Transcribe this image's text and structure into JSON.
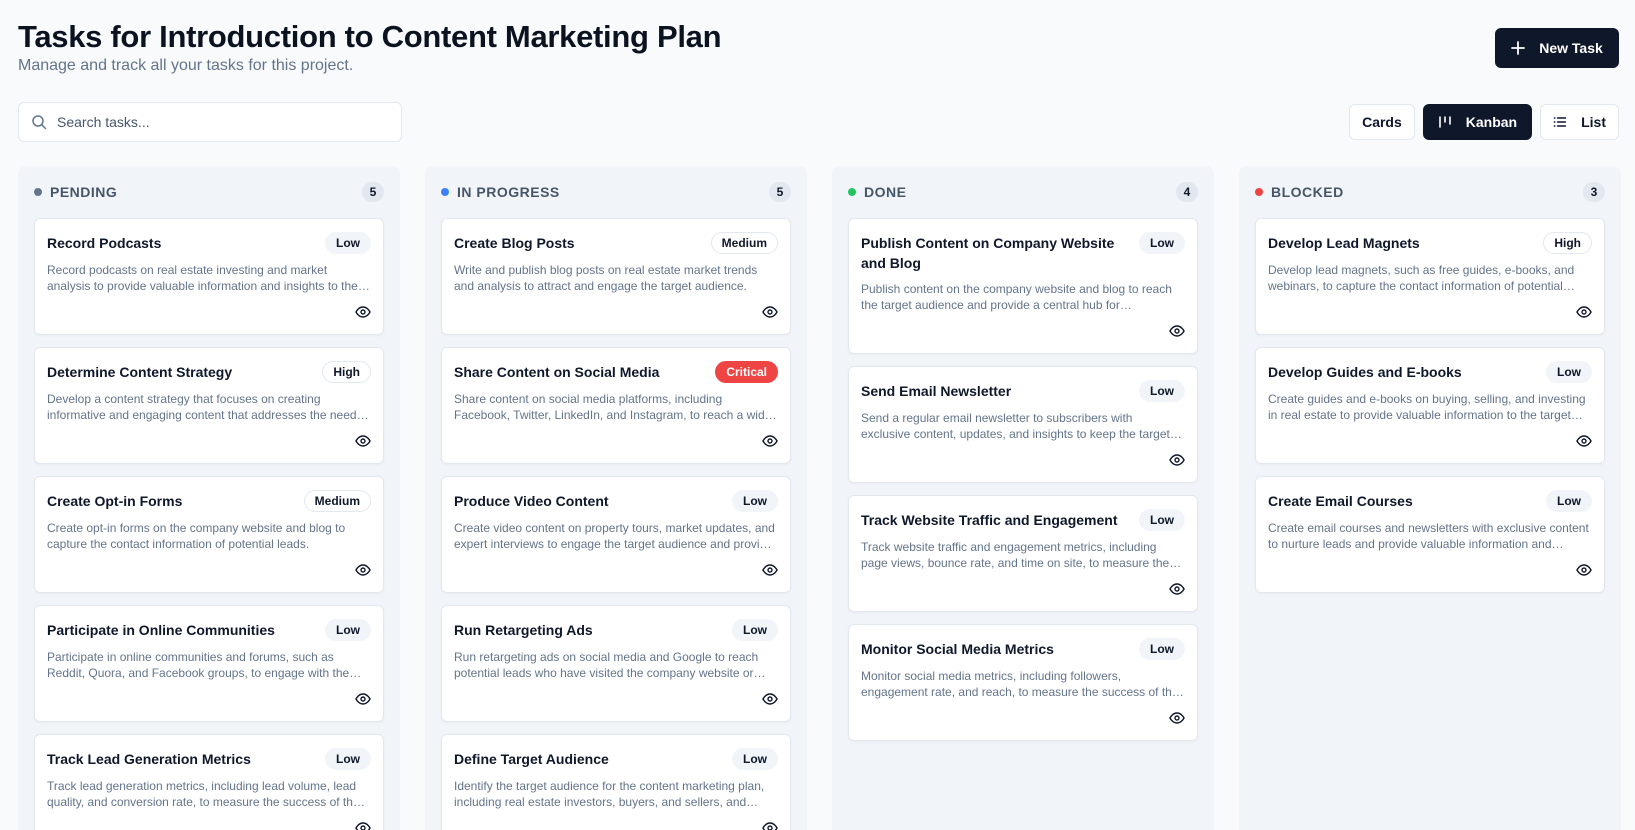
{
  "header": {
    "title": "Tasks for Introduction to Content Marketing Plan",
    "subtitle": "Manage and track all your tasks for this project.",
    "new_task_label": "New Task"
  },
  "search": {
    "placeholder": "Search tasks...",
    "value": ""
  },
  "views": {
    "cards": "Cards",
    "kanban": "Kanban",
    "list": "List",
    "active": "Kanban"
  },
  "colors": {
    "primary": "#0f172a",
    "pending": "#64748b",
    "in_progress": "#3b82f6",
    "done": "#22c55e",
    "blocked": "#ef4444",
    "critical": "#ef4444"
  },
  "columns": [
    {
      "title": "PENDING",
      "count": "5",
      "cards": [
        {
          "title": "Record Podcasts",
          "priority": "Low",
          "description": "Record podcasts on real estate investing and market analysis to provide valuable information and insights to the target audience."
        },
        {
          "title": "Determine Content Strategy",
          "priority": "High",
          "description": "Develop a content strategy that focuses on creating informative and engaging content that addresses the needs of the target audience."
        },
        {
          "title": "Create Opt-in Forms",
          "priority": "Medium",
          "description": "Create opt-in forms on the company website and blog to capture the contact information of potential leads."
        },
        {
          "title": "Participate in Online Communities",
          "priority": "Low",
          "description": "Participate in online communities and forums, such as Reddit, Quora, and Facebook groups, to engage with the target audience."
        },
        {
          "title": "Track Lead Generation Metrics",
          "priority": "Low",
          "description": "Track lead generation metrics, including lead volume, lead quality, and conversion rate, to measure the success of the strategy."
        }
      ]
    },
    {
      "title": "IN PROGRESS",
      "count": "5",
      "cards": [
        {
          "title": "Create Blog Posts",
          "priority": "Medium",
          "description": "Write and publish blog posts on real estate market trends and analysis to attract and engage the target audience."
        },
        {
          "title": "Share Content on Social Media",
          "priority": "Critical",
          "description": "Share content on social media platforms, including Facebook, Twitter, LinkedIn, and Instagram, to reach a wider audience."
        },
        {
          "title": "Produce Video Content",
          "priority": "Low",
          "description": "Create video content on property tours, market updates, and expert interviews to engage the target audience and provide value."
        },
        {
          "title": "Run Retargeting Ads",
          "priority": "Low",
          "description": "Run retargeting ads on social media and Google to reach potential leads who have visited the company website or blog."
        },
        {
          "title": "Define Target Audience",
          "priority": "Low",
          "description": "Identify the target audience for the content marketing plan, including real estate investors, buyers, and sellers, and agents."
        }
      ]
    },
    {
      "title": "DONE",
      "count": "4",
      "cards": [
        {
          "title": "Publish Content on Company Website and Blog",
          "priority": "Low",
          "description": "Publish content on the company website and blog to reach the target audience and provide a central hub for information."
        },
        {
          "title": "Send Email Newsletter",
          "priority": "Low",
          "description": "Send a regular email newsletter to subscribers with exclusive content, updates, and insights to keep the target audience engaged."
        },
        {
          "title": "Track Website Traffic and Engagement",
          "priority": "Low",
          "description": "Track website traffic and engagement metrics, including page views, bounce rate, and time on site, to measure the success of content."
        },
        {
          "title": "Monitor Social Media Metrics",
          "priority": "Low",
          "description": "Monitor social media metrics, including followers, engagement rate, and reach, to measure the success of the social media strategy."
        }
      ]
    },
    {
      "title": "BLOCKED",
      "count": "3",
      "cards": [
        {
          "title": "Develop Lead Magnets",
          "priority": "High",
          "description": "Develop lead magnets, such as free guides, e-books, and webinars, to capture the contact information of potential leads."
        },
        {
          "title": "Develop Guides and E-books",
          "priority": "Low",
          "description": "Create guides and e-books on buying, selling, and investing in real estate to provide valuable information to the target audience."
        },
        {
          "title": "Create Email Courses",
          "priority": "Low",
          "description": "Create email courses and newsletters with exclusive content to nurture leads and provide valuable information and insights."
        }
      ]
    }
  ]
}
